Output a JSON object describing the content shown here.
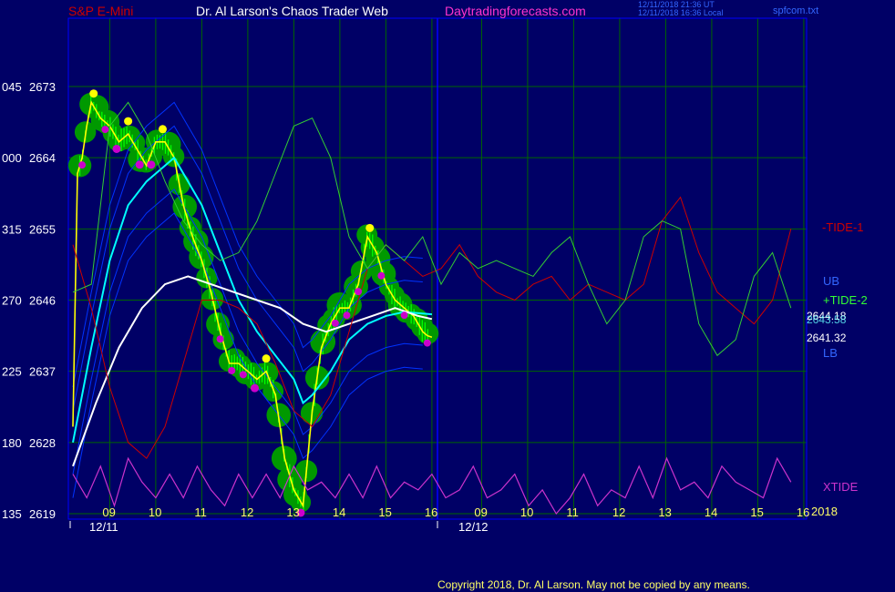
{
  "header": {
    "symbol": "S&P E-Mini",
    "title": "Dr. Al Larson's Chaos Trader Web",
    "site": "Daytradingforecasts.com",
    "time_utc": "12/11/2018 21:36 UT",
    "time_local": "12/11/2018 16:36 Local",
    "file": "spfcom.txt"
  },
  "footer": {
    "copyright": "Copyright 2018, Dr. Al Larson. May not be copied by any means."
  },
  "colors": {
    "background": "#000066",
    "grid": "#006600",
    "frame": "#0000ff",
    "price": "#ffff00",
    "ema_fast": "#00ffff",
    "ema_slow": "#ffffff",
    "tide1": "#cc0000",
    "tide2": "#33cc33",
    "xtide": "#cc33cc",
    "band": "#0033ff",
    "glow": "#009900",
    "bar": "#00ff00",
    "dot_high": "#ffff00",
    "dot_low": "#cc00cc"
  },
  "chart_data": {
    "type": "line",
    "title": "S&P E-Mini",
    "y_left_labels": [
      "045",
      "000",
      "315",
      "270",
      "225",
      "180",
      "135"
    ],
    "y_right_labels": [
      "2673",
      "2664",
      "2655",
      "2646",
      "2637",
      "2628",
      "2619"
    ],
    "ylim": [
      2619,
      2673
    ],
    "x_hour_labels": [
      "09",
      "10",
      "11",
      "12",
      "13",
      "14",
      "15",
      "16",
      "09",
      "10",
      "11",
      "12",
      "13",
      "14",
      "15",
      "16"
    ],
    "x_date_labels": [
      "12/11",
      "12/12"
    ],
    "year_label": "2018",
    "right_labels": {
      "tide1": "-TIDE-1",
      "ub": "UB",
      "tide2": "+TIDE-2",
      "value_a": "2644.18",
      "value_b": "2643.58",
      "value_c": "2641.32",
      "lb": "LB",
      "xtide": "XTIDE"
    },
    "series": [
      {
        "name": "Price",
        "x": [
          0.0,
          0.1,
          0.2,
          0.3,
          0.4,
          0.5,
          0.6,
          0.8,
          1.0,
          1.2,
          1.4,
          1.6,
          1.8,
          2.0,
          2.2,
          2.4,
          2.6,
          2.8,
          3.0,
          3.2,
          3.4,
          3.6,
          3.8,
          4.0,
          4.2,
          4.4,
          4.6,
          4.8,
          5.0,
          5.2,
          5.4,
          5.6,
          5.8,
          6.0,
          6.2,
          6.4,
          6.6,
          6.8,
          7.0,
          7.2,
          7.4,
          7.6,
          7.7,
          7.8
        ],
        "y": [
          2630,
          2662,
          2664,
          2668,
          2671,
          2670,
          2669,
          2668,
          2666,
          2667,
          2665,
          2663,
          2666,
          2666,
          2664,
          2658,
          2654,
          2651,
          2647,
          2642,
          2638,
          2638,
          2637,
          2636,
          2637,
          2634,
          2626,
          2622,
          2620,
          2632,
          2640,
          2643,
          2645,
          2645,
          2648,
          2654,
          2652,
          2648,
          2646,
          2645,
          2644,
          2642,
          2641.5,
          2641.3
        ]
      },
      {
        "name": "EMA fast",
        "x": [
          0.0,
          0.4,
          0.8,
          1.2,
          1.6,
          2.0,
          2.2,
          2.4,
          2.8,
          3.2,
          3.6,
          4.0,
          4.4,
          4.8,
          5.0,
          5.2,
          5.6,
          6.0,
          6.4,
          6.8,
          7.2,
          7.6,
          7.8
        ],
        "y": [
          2628,
          2640,
          2651,
          2658,
          2661,
          2663,
          2664,
          2662,
          2658,
          2652,
          2646,
          2642,
          2639,
          2636,
          2633,
          2634,
          2637,
          2641,
          2643,
          2644,
          2644.5,
          2644.3,
          2644.2
        ]
      },
      {
        "name": "EMA slow",
        "x": [
          0.0,
          0.5,
          1.0,
          1.5,
          2.0,
          2.5,
          3.0,
          3.5,
          4.0,
          4.5,
          5.0,
          5.5,
          6.0,
          6.5,
          7.0,
          7.5,
          7.8
        ],
        "y": [
          2625,
          2633,
          2640,
          2645,
          2648,
          2649,
          2648,
          2647,
          2646,
          2645,
          2643,
          2642,
          2643,
          2644,
          2645,
          2644,
          2643.6
        ]
      },
      {
        "name": "-TIDE-1",
        "x": [
          0.0,
          0.4,
          0.8,
          1.2,
          1.6,
          2.0,
          2.4,
          2.8,
          3.2,
          3.6,
          4.0,
          4.4,
          4.8,
          5.2,
          5.6,
          6.0,
          6.4,
          6.8,
          7.2,
          7.6,
          8.0,
          8.4,
          8.8,
          9.2,
          9.6,
          10.0,
          10.4,
          10.8,
          11.2,
          11.6,
          12.0,
          12.4,
          12.8,
          13.2,
          13.6,
          14.0,
          14.4,
          14.8,
          15.2,
          15.6
        ],
        "y": [
          2653,
          2645,
          2635,
          2628,
          2626,
          2630,
          2638,
          2646,
          2646,
          2645,
          2643,
          2638,
          2632,
          2630,
          2634,
          2642,
          2650,
          2653,
          2651,
          2649,
          2650,
          2653,
          2649,
          2647,
          2646,
          2648,
          2649,
          2646,
          2648,
          2647,
          2646,
          2648,
          2656,
          2659,
          2652,
          2647,
          2645,
          2643,
          2646,
          2655
        ]
      },
      {
        "name": "+TIDE-2",
        "x": [
          0.0,
          0.4,
          0.8,
          1.2,
          1.6,
          2.0,
          2.4,
          2.8,
          3.2,
          3.6,
          4.0,
          4.4,
          4.8,
          5.2,
          5.6,
          6.0,
          6.4,
          6.8,
          7.2,
          7.6,
          8.0,
          8.4,
          8.8,
          9.2,
          9.6,
          10.0,
          10.4,
          10.8,
          11.2,
          11.6,
          12.0,
          12.4,
          12.8,
          13.2,
          13.6,
          14.0,
          14.4,
          14.8,
          15.2,
          15.6
        ],
        "y": [
          2647,
          2648,
          2668,
          2671,
          2667,
          2661,
          2656,
          2653,
          2651,
          2652,
          2656,
          2662,
          2668,
          2669,
          2664,
          2654,
          2650,
          2653,
          2651,
          2654,
          2648,
          2652,
          2650,
          2651,
          2650,
          2649,
          2652,
          2654,
          2648,
          2643,
          2646,
          2654,
          2656,
          2655,
          2643,
          2639,
          2641,
          2649,
          2652,
          2645
        ]
      },
      {
        "name": "XTIDE",
        "x": [
          0.0,
          0.3,
          0.6,
          0.9,
          1.2,
          1.5,
          1.8,
          2.1,
          2.4,
          2.7,
          3.0,
          3.3,
          3.6,
          3.9,
          4.2,
          4.5,
          4.8,
          5.1,
          5.4,
          5.7,
          6.0,
          6.3,
          6.6,
          6.9,
          7.2,
          7.5,
          7.8,
          8.1,
          8.4,
          8.7,
          9.0,
          9.3,
          9.6,
          9.9,
          10.2,
          10.5,
          10.8,
          11.1,
          11.4,
          11.7,
          12.0,
          12.3,
          12.6,
          12.9,
          13.2,
          13.5,
          13.8,
          14.1,
          14.4,
          14.7,
          15.0,
          15.3,
          15.6
        ],
        "y": [
          2624,
          2621,
          2625,
          2620,
          2626,
          2623,
          2621,
          2624,
          2621,
          2625,
          2622,
          2620,
          2624,
          2621,
          2624,
          2621,
          2625,
          2622,
          2623,
          2621,
          2624,
          2621,
          2625,
          2621,
          2623,
          2622,
          2624,
          2621,
          2622,
          2625,
          2621,
          2622,
          2624,
          2620,
          2622,
          2619,
          2621,
          2624,
          2620,
          2622,
          2621,
          2625,
          2621,
          2626,
          2622,
          2623,
          2621,
          2625,
          2623,
          2622,
          2621,
          2626,
          2623
        ]
      }
    ]
  }
}
